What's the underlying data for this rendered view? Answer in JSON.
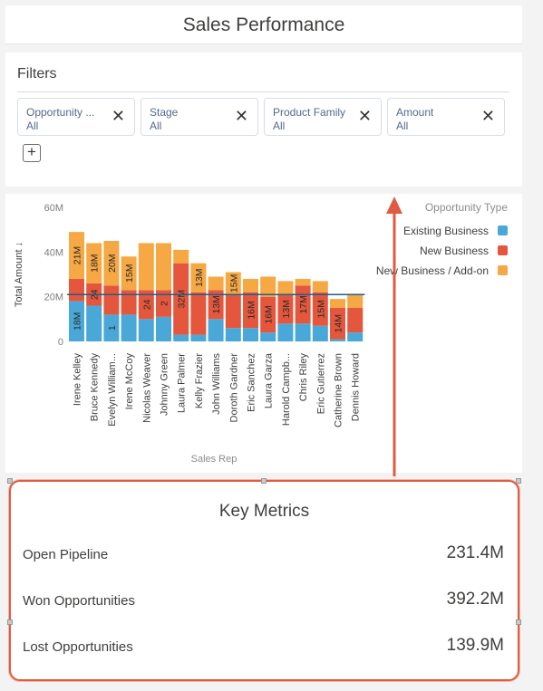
{
  "page_title": "Sales Performance",
  "filters": {
    "title": "Filters",
    "items": [
      {
        "label": "Opportunity ...",
        "value": "All"
      },
      {
        "label": "Stage",
        "value": "All"
      },
      {
        "label": "Product Family",
        "value": "All"
      },
      {
        "label": "Amount",
        "value": "All"
      }
    ],
    "close_glyph": "✕",
    "add_glyph": "+"
  },
  "chart_data": {
    "type": "bar",
    "stacked": true,
    "xlabel": "Sales Rep",
    "ylabel": "Total Amount ↓",
    "ylim": [
      0,
      60
    ],
    "yticks": [
      "0",
      "20M",
      "40M",
      "60M"
    ],
    "legend_title": "Opportunity Type",
    "legend_position": "right",
    "reference_line": 21,
    "categories": [
      "Irene Kelley",
      "Bruce Kennedy",
      "Evelyn William...",
      "Irene McCoy",
      "Nicolas Weaver",
      "Johnny Green",
      "Laura Palmer",
      "Kelly Frazier",
      "John Williams",
      "Doroth Gardner",
      "Eric Sanchez",
      "Laura Garza",
      "Harold Campb...",
      "Chris Riley",
      "Eric Gutierrez",
      "Catherine Brown",
      "Dennis Howard"
    ],
    "series": [
      {
        "name": "Existing Business",
        "color": "#4aa8d8",
        "values": [
          18,
          16,
          12,
          12,
          10,
          11,
          3,
          3,
          10,
          6,
          6,
          4,
          8,
          8,
          7,
          1,
          4
        ]
      },
      {
        "name": "New Business",
        "color": "#e4573d",
        "values": [
          10,
          10,
          13,
          11,
          13,
          12,
          32,
          19,
          13,
          15,
          16,
          16,
          13,
          17,
          15,
          14,
          11
        ]
      },
      {
        "name": "New Business / Add-on",
        "color": "#f5a844",
        "values": [
          21,
          18,
          20,
          15,
          21,
          21,
          6,
          13,
          6,
          10,
          6,
          9,
          6,
          3,
          5,
          4,
          6
        ]
      }
    ],
    "bar_labels": [
      [
        "18M",
        "",
        "21M"
      ],
      [
        "",
        "24",
        "18M"
      ],
      [
        "1",
        "",
        "20M"
      ],
      [
        "",
        "",
        "15M"
      ],
      [
        "",
        "24",
        ""
      ],
      [
        "",
        "2",
        ""
      ],
      [
        "",
        "32M",
        ""
      ],
      [
        "",
        "",
        "13M"
      ],
      [
        "",
        "13M",
        ""
      ],
      [
        "",
        "",
        "15M"
      ],
      [
        "",
        "16M",
        ""
      ],
      [
        "",
        "16M",
        ""
      ],
      [
        "",
        "13M",
        ""
      ],
      [
        "",
        "17M",
        ""
      ],
      [
        "",
        "15M",
        ""
      ],
      [
        "",
        "14M",
        ""
      ],
      [
        "",
        "",
        ""
      ]
    ]
  },
  "metrics": {
    "title": "Key Metrics",
    "rows": [
      {
        "label": "Open Pipeline",
        "value": "231.4M"
      },
      {
        "label": "Won Opportunities",
        "value": "392.2M"
      },
      {
        "label": "Lost Opportunities",
        "value": "139.9M"
      }
    ]
  }
}
